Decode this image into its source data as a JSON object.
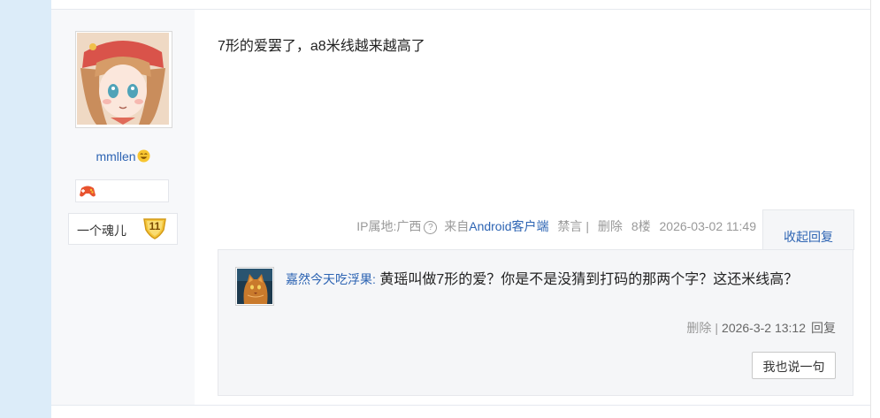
{
  "author": {
    "username": "mmllen",
    "username_emoji": "grinning-emoji",
    "badge_icon": "game-controller-badge-icon",
    "level_name": "一个魂儿",
    "level_number": "11"
  },
  "post": {
    "content": "7形的爱罢了，a8米线越来越高了",
    "ip_label": "IP属地:广西",
    "source_prefix": "来自",
    "source_link": "Android客户端",
    "ban_label": "禁言",
    "separator": "|",
    "delete_label": "删除",
    "floor": "8楼",
    "datetime": "2026-03-02 11:49",
    "collapse_label": "收起回复"
  },
  "reply": {
    "user": "嘉然今天吃浮果:",
    "text": "黄瑶叫做7形的爱？你是不是没猜到打码的那两个字？这还米线高？",
    "delete_label": "删除",
    "separator": "|",
    "datetime": "2026-3-2 13:12",
    "reply_label": "回复",
    "say_button": "我也说一句"
  },
  "colors": {
    "link": "#2d64b3",
    "meta": "#999999",
    "sidebar": "#dcecf9",
    "author_bg": "#f7f8fa",
    "reply_bg": "#f5f6f8"
  }
}
